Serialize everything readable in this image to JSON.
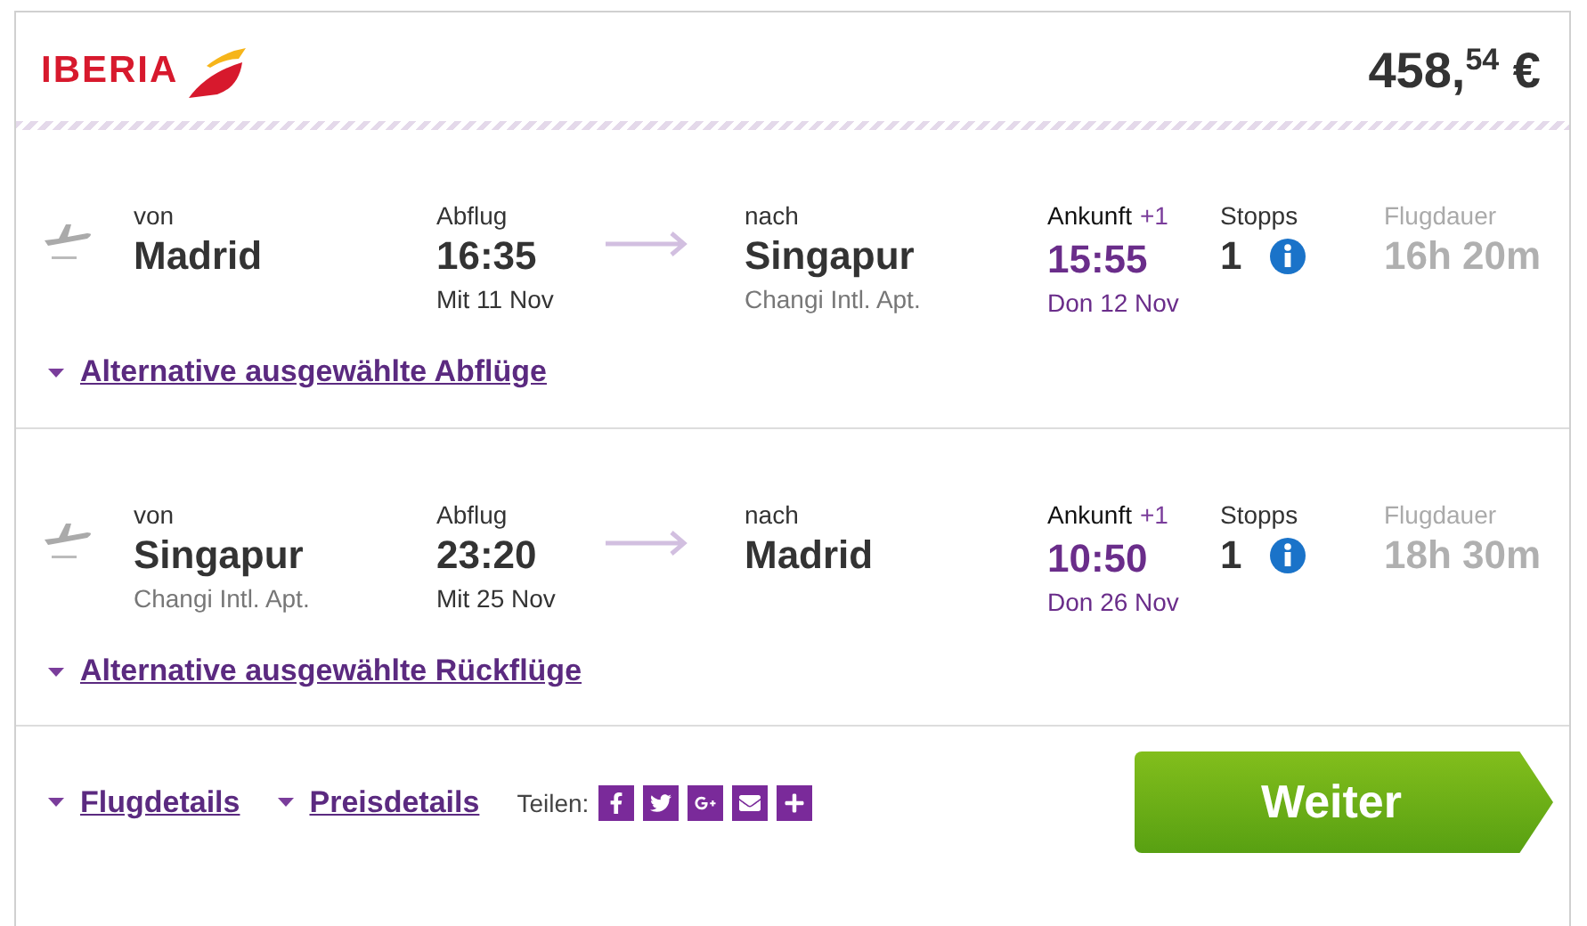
{
  "airline": {
    "name": "IBERIA"
  },
  "price": "458,$^{54}$ €",
  "flights": [
    {
      "from_label": "von",
      "from_city": "Madrid",
      "dep_label": "Abflug",
      "dep_time": "16:35",
      "dep_date": "Mit 11 Nov",
      "to_label": "nach",
      "to_city": "Singapur",
      "to_airport": "Changi Intl. Apt.",
      "arr_label": "Ankunft",
      "day_offset": "+1",
      "arr_time": "15:55",
      "arr_date": "Don 12 Nov",
      "stops_label": "Stopps",
      "stops": "1",
      "duration_label": "Flugdauer",
      "duration": "16h 20m",
      "alternatives": "Alternative ausgewählte Abflüge"
    },
    {
      "from_label": "von",
      "from_city": "Singapur",
      "from_airport": "Changi Intl. Apt.",
      "dep_label": "Abflug",
      "dep_time": "23:20",
      "dep_date": "Mit 25 Nov",
      "to_label": "nach",
      "to_city": "Madrid",
      "arr_label": "Ankunft",
      "day_offset": "+1",
      "arr_time": "10:50",
      "arr_date": "Don 26 Nov",
      "stops_label": "Stopps",
      "stops": "1",
      "duration_label": "Flugdauer",
      "duration": "18h 30m",
      "alternatives": "Alternative ausgewählte Rückflüge"
    }
  ],
  "footer": {
    "links": [
      "Flugdetails",
      "Preisdetails"
    ],
    "share_label": "Teilen:",
    "button": "Weiter"
  }
}
